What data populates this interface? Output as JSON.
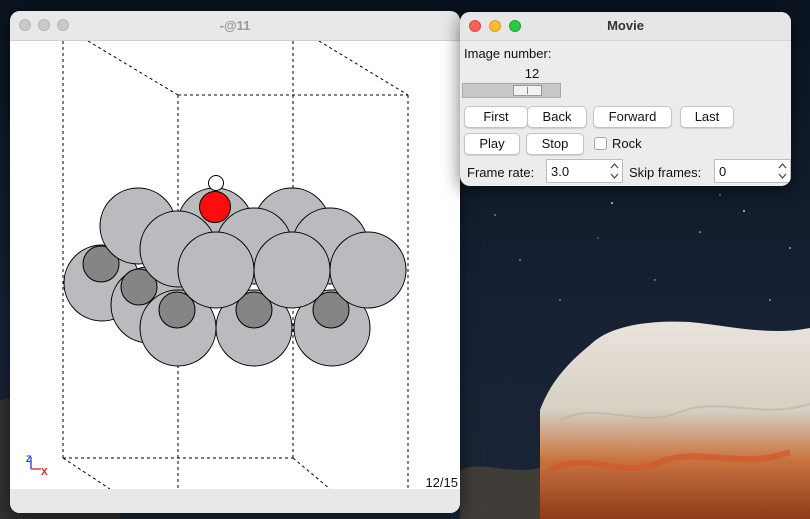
{
  "viewer": {
    "title": "-@11",
    "frame_label": "12/15",
    "axes": {
      "z_label": "Z",
      "x_label": "X"
    }
  },
  "movie": {
    "title": "Movie",
    "image_number_label": "Image number:",
    "slider_value": "12",
    "slider_fraction": 0.73,
    "buttons": {
      "first": "First",
      "back": "Back",
      "forward": "Forward",
      "last": "Last",
      "play": "Play",
      "stop": "Stop"
    },
    "rock_label": "Rock",
    "rock_checked": false,
    "frame_rate_label": "Frame rate:",
    "frame_rate_value": "3.0",
    "skip_frames_label": "Skip frames:",
    "skip_frames_value": "0"
  },
  "colors": {
    "metal_atom": "#b9bbbe",
    "subsurface_atom": "#858585",
    "oxygen_atom": "#ff0d0d",
    "hydrogen_atom": "#ffffff",
    "close_button": "#fe5f57",
    "minimize_button": "#febc2e",
    "zoom_button": "#28c840",
    "axis_z": "#2a3ad6",
    "axis_x": "#e0241a"
  }
}
